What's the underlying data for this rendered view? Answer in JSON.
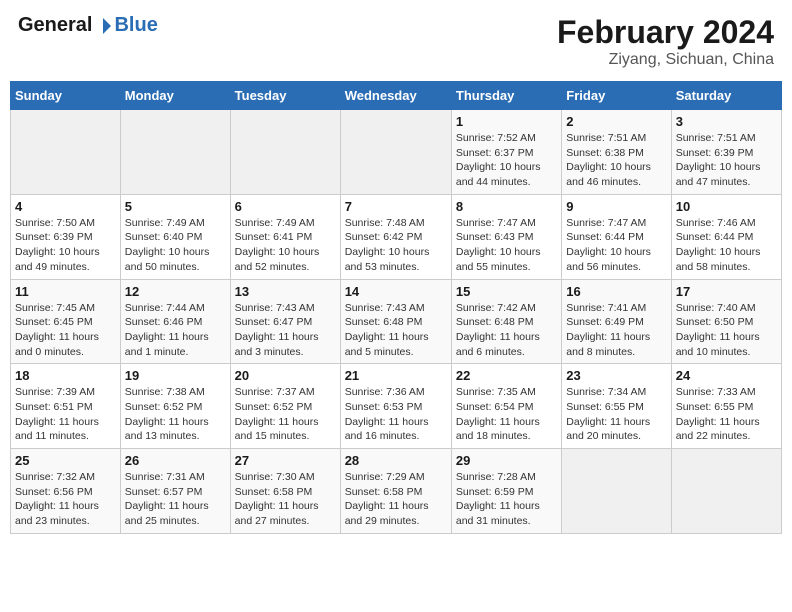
{
  "header": {
    "logo_line1": "General",
    "logo_line2": "Blue",
    "title": "February 2024",
    "subtitle": "Ziyang, Sichuan, China"
  },
  "days_of_week": [
    "Sunday",
    "Monday",
    "Tuesday",
    "Wednesday",
    "Thursday",
    "Friday",
    "Saturday"
  ],
  "weeks": [
    [
      {
        "day": "",
        "info": ""
      },
      {
        "day": "",
        "info": ""
      },
      {
        "day": "",
        "info": ""
      },
      {
        "day": "",
        "info": ""
      },
      {
        "day": "1",
        "info": "Sunrise: 7:52 AM\nSunset: 6:37 PM\nDaylight: 10 hours\nand 44 minutes."
      },
      {
        "day": "2",
        "info": "Sunrise: 7:51 AM\nSunset: 6:38 PM\nDaylight: 10 hours\nand 46 minutes."
      },
      {
        "day": "3",
        "info": "Sunrise: 7:51 AM\nSunset: 6:39 PM\nDaylight: 10 hours\nand 47 minutes."
      }
    ],
    [
      {
        "day": "4",
        "info": "Sunrise: 7:50 AM\nSunset: 6:39 PM\nDaylight: 10 hours\nand 49 minutes."
      },
      {
        "day": "5",
        "info": "Sunrise: 7:49 AM\nSunset: 6:40 PM\nDaylight: 10 hours\nand 50 minutes."
      },
      {
        "day": "6",
        "info": "Sunrise: 7:49 AM\nSunset: 6:41 PM\nDaylight: 10 hours\nand 52 minutes."
      },
      {
        "day": "7",
        "info": "Sunrise: 7:48 AM\nSunset: 6:42 PM\nDaylight: 10 hours\nand 53 minutes."
      },
      {
        "day": "8",
        "info": "Sunrise: 7:47 AM\nSunset: 6:43 PM\nDaylight: 10 hours\nand 55 minutes."
      },
      {
        "day": "9",
        "info": "Sunrise: 7:47 AM\nSunset: 6:44 PM\nDaylight: 10 hours\nand 56 minutes."
      },
      {
        "day": "10",
        "info": "Sunrise: 7:46 AM\nSunset: 6:44 PM\nDaylight: 10 hours\nand 58 minutes."
      }
    ],
    [
      {
        "day": "11",
        "info": "Sunrise: 7:45 AM\nSunset: 6:45 PM\nDaylight: 11 hours\nand 0 minutes."
      },
      {
        "day": "12",
        "info": "Sunrise: 7:44 AM\nSunset: 6:46 PM\nDaylight: 11 hours\nand 1 minute."
      },
      {
        "day": "13",
        "info": "Sunrise: 7:43 AM\nSunset: 6:47 PM\nDaylight: 11 hours\nand 3 minutes."
      },
      {
        "day": "14",
        "info": "Sunrise: 7:43 AM\nSunset: 6:48 PM\nDaylight: 11 hours\nand 5 minutes."
      },
      {
        "day": "15",
        "info": "Sunrise: 7:42 AM\nSunset: 6:48 PM\nDaylight: 11 hours\nand 6 minutes."
      },
      {
        "day": "16",
        "info": "Sunrise: 7:41 AM\nSunset: 6:49 PM\nDaylight: 11 hours\nand 8 minutes."
      },
      {
        "day": "17",
        "info": "Sunrise: 7:40 AM\nSunset: 6:50 PM\nDaylight: 11 hours\nand 10 minutes."
      }
    ],
    [
      {
        "day": "18",
        "info": "Sunrise: 7:39 AM\nSunset: 6:51 PM\nDaylight: 11 hours\nand 11 minutes."
      },
      {
        "day": "19",
        "info": "Sunrise: 7:38 AM\nSunset: 6:52 PM\nDaylight: 11 hours\nand 13 minutes."
      },
      {
        "day": "20",
        "info": "Sunrise: 7:37 AM\nSunset: 6:52 PM\nDaylight: 11 hours\nand 15 minutes."
      },
      {
        "day": "21",
        "info": "Sunrise: 7:36 AM\nSunset: 6:53 PM\nDaylight: 11 hours\nand 16 minutes."
      },
      {
        "day": "22",
        "info": "Sunrise: 7:35 AM\nSunset: 6:54 PM\nDaylight: 11 hours\nand 18 minutes."
      },
      {
        "day": "23",
        "info": "Sunrise: 7:34 AM\nSunset: 6:55 PM\nDaylight: 11 hours\nand 20 minutes."
      },
      {
        "day": "24",
        "info": "Sunrise: 7:33 AM\nSunset: 6:55 PM\nDaylight: 11 hours\nand 22 minutes."
      }
    ],
    [
      {
        "day": "25",
        "info": "Sunrise: 7:32 AM\nSunset: 6:56 PM\nDaylight: 11 hours\nand 23 minutes."
      },
      {
        "day": "26",
        "info": "Sunrise: 7:31 AM\nSunset: 6:57 PM\nDaylight: 11 hours\nand 25 minutes."
      },
      {
        "day": "27",
        "info": "Sunrise: 7:30 AM\nSunset: 6:58 PM\nDaylight: 11 hours\nand 27 minutes."
      },
      {
        "day": "28",
        "info": "Sunrise: 7:29 AM\nSunset: 6:58 PM\nDaylight: 11 hours\nand 29 minutes."
      },
      {
        "day": "29",
        "info": "Sunrise: 7:28 AM\nSunset: 6:59 PM\nDaylight: 11 hours\nand 31 minutes."
      },
      {
        "day": "",
        "info": ""
      },
      {
        "day": "",
        "info": ""
      }
    ]
  ]
}
